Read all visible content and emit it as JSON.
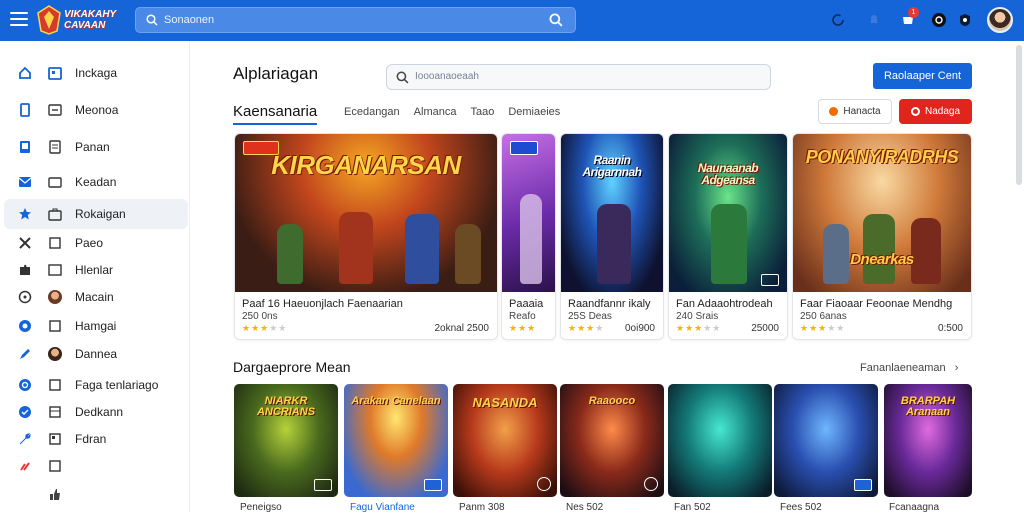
{
  "topbar": {
    "logo_line1": "VIKAKAHY",
    "logo_line2": "CAVAAN",
    "search_placeholder": "Sonaonen",
    "notification_count": "1",
    "colors": {
      "bar": "#1565d8",
      "search": "#4a8ae6"
    }
  },
  "sidebar": {
    "items": [
      {
        "label": "Inckaga"
      },
      {
        "label": "Meonoa"
      },
      {
        "label": "Panan"
      },
      {
        "label": "Keadan"
      },
      {
        "label": "Rokaigan",
        "active": true
      },
      {
        "label": "Paeo"
      },
      {
        "label": "Hlenlar"
      },
      {
        "label": "Macain"
      },
      {
        "label": "Hamgai"
      },
      {
        "label": "Dannea"
      },
      {
        "label": "Faga tenlariago"
      },
      {
        "label": "Dedkann"
      },
      {
        "label": "Fdran"
      },
      {
        "label": ""
      },
      {
        "label": ""
      }
    ]
  },
  "main": {
    "title": "Alplariagan",
    "search_placeholder": "Ioooanaoeaah",
    "primary_button": "Raolaaper Cent",
    "section_title": "Kaensanaria",
    "tabs": [
      "Ecedangan",
      "Almanca",
      "Taao",
      "Demiaeies"
    ],
    "outline_button": "Hanacta",
    "red_button": "Nadaga",
    "colors": {
      "accent": "#1565d8",
      "red": "#e2251c",
      "star": "#f5b400"
    }
  },
  "featured": [
    {
      "art_title": "KIRGANARSAN",
      "name": "Paaf 16 Haeuonjlach Faenaarian",
      "sub": "250 0ns",
      "rating": 3,
      "price": "2oknal  2500"
    },
    {
      "art_title": "",
      "name": "Paaaia",
      "sub": "Reafo",
      "rating": 3,
      "price": ""
    },
    {
      "art_title": "Raanin Arigarnnah",
      "name": "Raandfannr ikaly",
      "sub": "25S Deas",
      "rating": 3,
      "price": "0oi900"
    },
    {
      "art_title": "Naunaanab Adgeansa",
      "name": "Fan Adaaohtrodeah",
      "sub": "240 Srais",
      "rating": 3,
      "price": "25000"
    },
    {
      "art_title": "PONANYIRADRHS",
      "name": "Faar Fiaoaar Feoonae Mendhg",
      "sub": "250 6anas",
      "rating": 3,
      "price": "0:500"
    }
  ],
  "feat_footer_titles": [
    "",
    "",
    "",
    "",
    "Dnearkas"
  ],
  "second_section": {
    "title": "Dargaeprore Mean",
    "link": "Fananlaeneaman"
  },
  "tiles": [
    {
      "title": "NIARKR ANCRIANS",
      "caption": "Peneigso"
    },
    {
      "title": "Arakan Canelaan",
      "caption": "Fagu Vianfane"
    },
    {
      "title": "NASANDA",
      "caption": "Panm 308"
    },
    {
      "title": "Raaooco",
      "caption": "Nes 502"
    },
    {
      "title": "",
      "caption": "Fan 502"
    },
    {
      "title": "",
      "caption": "Fees 502"
    },
    {
      "title": "BRARPAH Aranaan",
      "caption": "Fcanaagna"
    }
  ]
}
